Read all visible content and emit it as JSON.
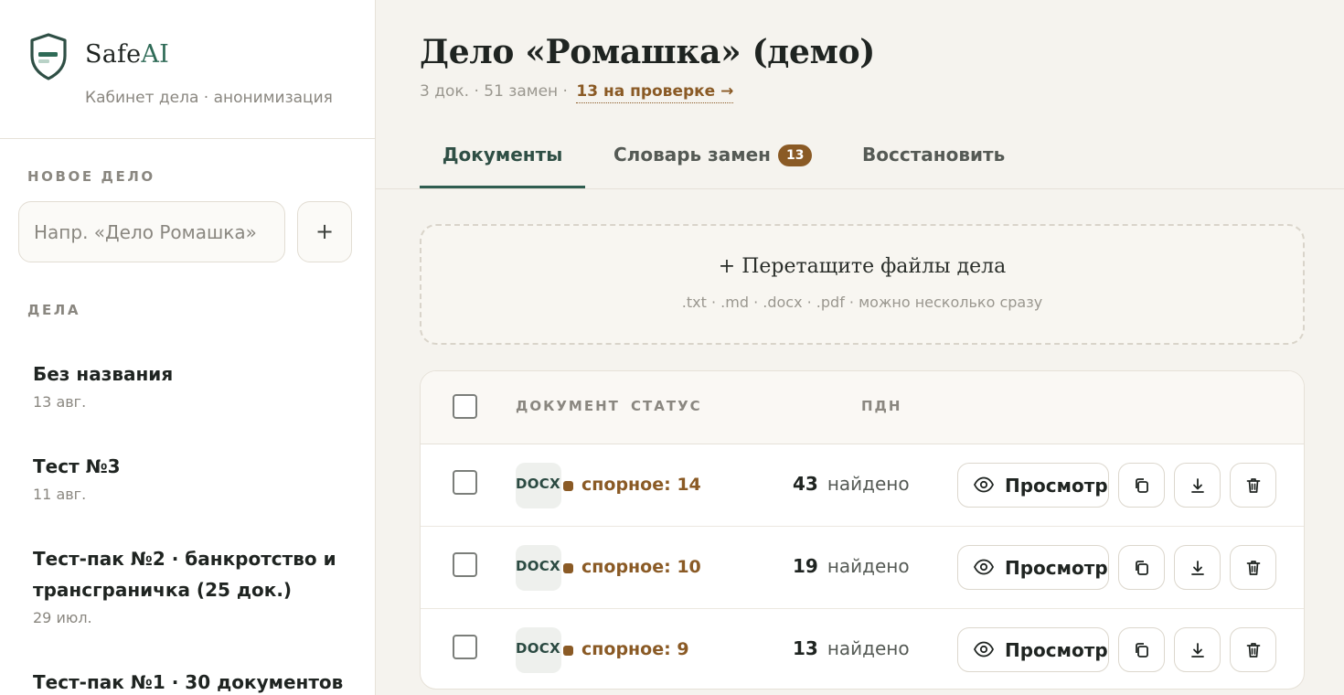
{
  "brand": {
    "name_prefix": "Safe",
    "name_suffix": "AI",
    "subtitle": "Кабинет дела · анонимизация",
    "accent_color": "#2f6b57"
  },
  "sidebar": {
    "new_case_label": "НОВОЕ ДЕЛО",
    "new_case_placeholder": "Напр. «Дело Ромашка»",
    "new_case_add": "+",
    "cases_label": "ДЕЛА",
    "cases": [
      {
        "title": "Без названия",
        "date": "13 авг."
      },
      {
        "title": "Тест №3",
        "date": "11 авг."
      },
      {
        "title": "Тест-пак №2 · банкротство и трансграничка (25 док.)",
        "date": "29 июл."
      },
      {
        "title": "Тест-пак №1 · 30 документов",
        "date": ""
      }
    ]
  },
  "header": {
    "title": "Дело «Ромашка» (демо)",
    "meta": "3 док. · 51 замен ·",
    "review_link": "13 на проверке →"
  },
  "tabs": [
    {
      "label": "Документы",
      "active": true
    },
    {
      "label": "Словарь замен",
      "count": "13"
    },
    {
      "label": "Восстановить"
    }
  ],
  "dropzone": {
    "title": "+ Перетащите файлы дела",
    "subtitle": ".txt · .md · .docx · .pdf · можно несколько сразу"
  },
  "table": {
    "columns": {
      "document": "ДОКУМЕНТ",
      "status": "СТАТУС",
      "pdn": "ПДН"
    },
    "rows": [
      {
        "ext": "DOCX",
        "status": "спорное: 14",
        "pdn_count": "43",
        "pdn_label": "найдено",
        "view_label": "Просмотр"
      },
      {
        "ext": "DOCX",
        "status": "спорное: 10",
        "pdn_count": "19",
        "pdn_label": "найдено",
        "view_label": "Просмотр"
      },
      {
        "ext": "DOCX",
        "status": "спорное: 9",
        "pdn_count": "13",
        "pdn_label": "найдено",
        "view_label": "Просмотр"
      }
    ]
  },
  "icons": [
    "shield-icon",
    "plus-icon",
    "eye-icon",
    "copy-icon",
    "download-icon",
    "trash-icon"
  ],
  "colors": {
    "status_brown": "#8a5a25",
    "brand_green": "#2f5d50",
    "background": "#f5f3ee"
  }
}
